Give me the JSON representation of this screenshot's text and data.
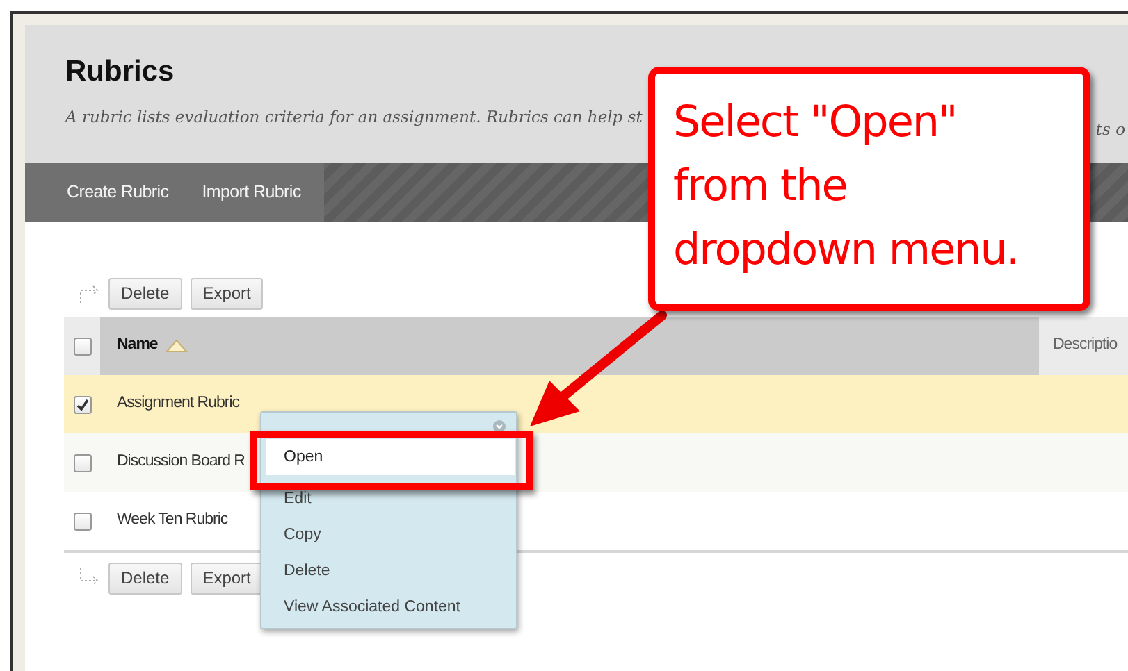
{
  "page": {
    "title": "Rubrics",
    "description": "A rubric lists evaluation criteria for an assignment. Rubrics can help st",
    "description_tail": "ts o"
  },
  "action_bar": [
    "Create Rubric",
    "Import Rubric"
  ],
  "top_buttons": [
    "Delete",
    "Export"
  ],
  "table": {
    "select_all": {
      "checked": false
    },
    "columns": [
      {
        "label": "Name",
        "sorted": true
      },
      {
        "label": "Descriptio",
        "sorted": false
      }
    ],
    "rows": [
      {
        "name": "Assignment Rubric",
        "checked": true
      },
      {
        "name": "Discussion Board R",
        "checked": false
      },
      {
        "name": "Week Ten Rubric",
        "checked": false
      }
    ]
  },
  "bottom_buttons": [
    "Delete",
    "Export"
  ],
  "context_menu": {
    "items": [
      {
        "label": "Open",
        "selected": true
      },
      {
        "label": "Edit",
        "selected": false
      },
      {
        "label": "Copy",
        "selected": false
      },
      {
        "label": "Delete",
        "selected": false
      },
      {
        "label": "View Associated Content",
        "selected": false
      }
    ]
  },
  "callout": {
    "text": "Select \"Open\" from the dropdown menu."
  }
}
